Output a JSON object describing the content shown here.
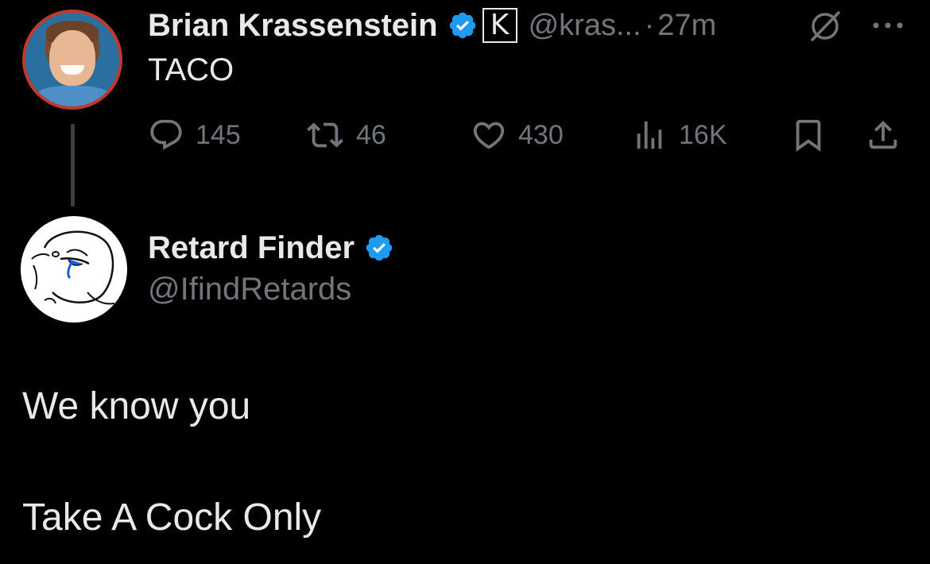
{
  "parent_tweet": {
    "author": {
      "display_name": "Brian Krassenstein",
      "handle": "@kras...",
      "verified": true,
      "affiliate_badge": "K"
    },
    "separator": "·",
    "time": "27m",
    "text": "TACO",
    "actions": {
      "replies": "145",
      "reposts": "46",
      "likes": "430",
      "views": "16K"
    },
    "icons": [
      "grok-icon",
      "more-icon",
      "reply-icon",
      "repost-icon",
      "like-icon",
      "views-icon",
      "bookmark-icon",
      "share-icon"
    ]
  },
  "reply": {
    "author": {
      "display_name": "Retard Finder",
      "handle": "@IfindRetards",
      "verified": true
    },
    "lines": [
      "We know you",
      "Take A Cock Only"
    ]
  },
  "colors": {
    "background": "#000000",
    "primary_text": "#e7e9ea",
    "secondary_text": "#71767b",
    "verified_blue": "#1d9bf0",
    "thread_line": "#3a3d40"
  }
}
